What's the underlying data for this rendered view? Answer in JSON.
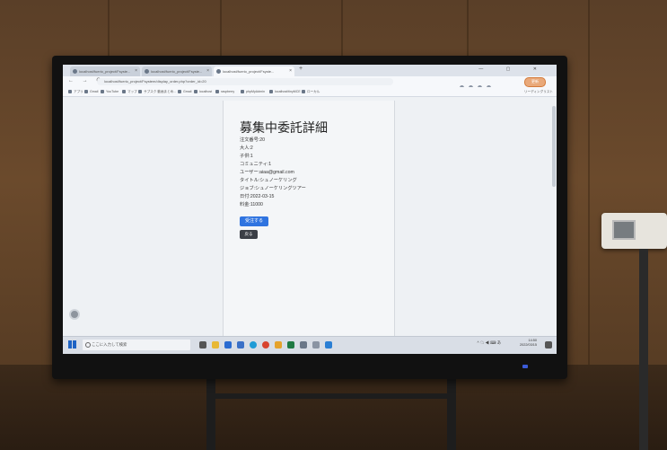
{
  "browser": {
    "tabs": [
      {
        "label": "localhost/fuerio_project/Fsyste...",
        "active": false
      },
      {
        "label": "localhost/fuerio_project/Fsyste...",
        "active": false
      },
      {
        "label": "localhost/fuerio_project/Fsyste...",
        "active": true
      }
    ],
    "new_tab": "+",
    "window_controls": "— ▢ ✕",
    "nav_buttons": "← → C",
    "url": "localhost/fuerio_project/Fsystem/display_order.php?order_id=20",
    "profile_label": "更新",
    "bookmarks": [
      "アプリ",
      "Gmail",
      "YouTube",
      "マップ",
      "サブスク 動画まとめ...",
      "Gmail",
      "localhost",
      "raspberry",
      "phpMyAdmin",
      "localhost/tinyMCE",
      "ローカル"
    ],
    "reading_list": "リーディングリスト"
  },
  "page": {
    "title": "募集中委託詳細",
    "info_lines": [
      "注文番号:20",
      "大人:2",
      "子供:1",
      "コミュニティ:1",
      "ユーザー:aiaa@gmail.com",
      "タイトル:シュノーケリング",
      "ジョブ:シュノーケリングツアー",
      "日付:2022-03-15",
      "料金:11000"
    ],
    "primary_button": "受注する",
    "back_button": "戻る"
  },
  "taskbar": {
    "search_placeholder": "ここに入力して検索",
    "tray_text": "^ ☁ ◀ ⌨ あ",
    "clock_time": "14:50",
    "clock_date": "2022/03/15"
  },
  "colors": {
    "accent": "#2f74e0",
    "dark_button": "#3b3f46",
    "wall": "#5a3f28"
  }
}
